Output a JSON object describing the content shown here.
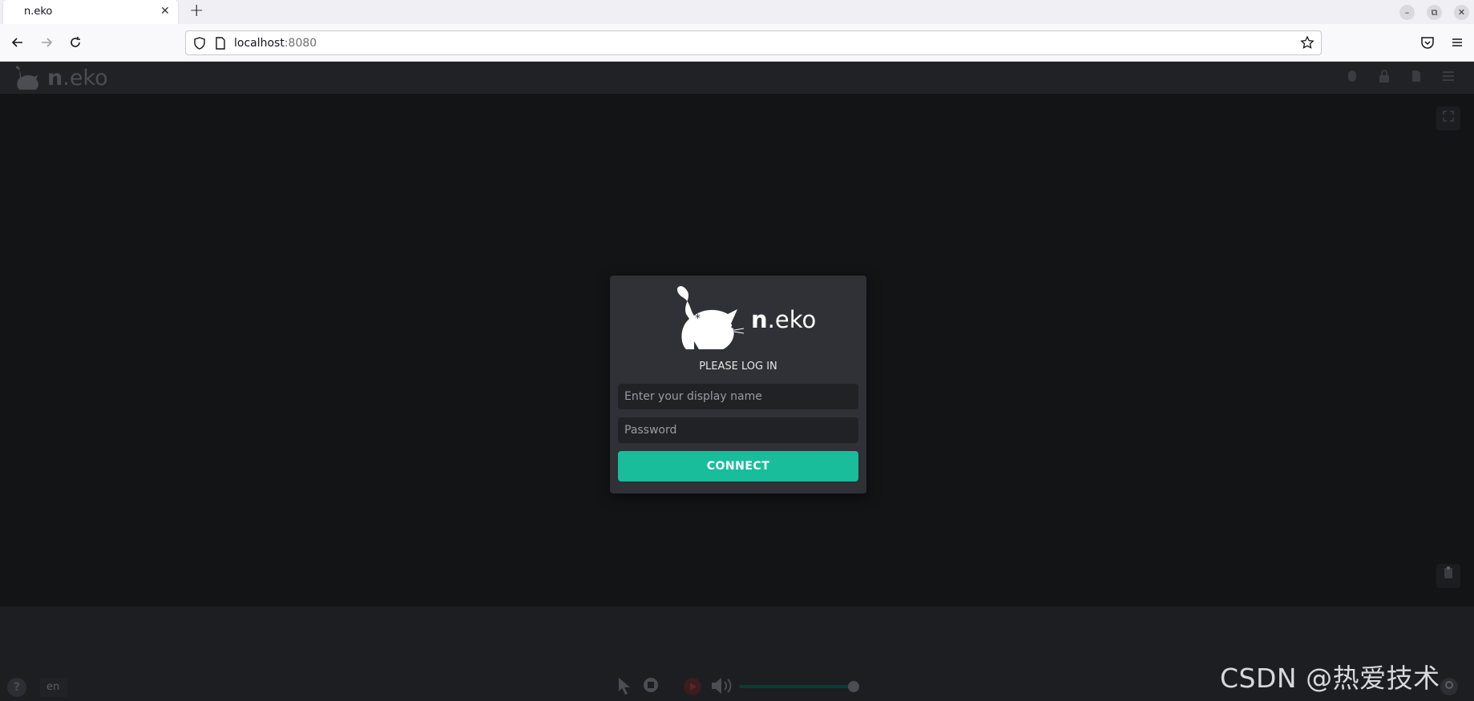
{
  "browser": {
    "tab_title": "n.eko",
    "tab_close": "✕",
    "new_tab": "+",
    "url_host": "localhost",
    "url_port": ":8080",
    "window_controls": [
      "–",
      "⧉",
      "✕"
    ]
  },
  "header": {
    "logo_bold": "n",
    "logo_rest": ".eko"
  },
  "login": {
    "logo_bold": "n",
    "logo_rest": ".eko",
    "heading": "PLEASE LOG IN",
    "display_name_placeholder": "Enter your display name",
    "password_placeholder": "Password",
    "connect_label": "CONNECT"
  },
  "footer": {
    "help": "?",
    "language": "en"
  },
  "watermark": "CSDN @热爱技术。",
  "colors": {
    "accent": "#19bd9c",
    "card": "#2f3136",
    "background": "#131416"
  },
  "icons": [
    "mouse-icon",
    "lock-icon",
    "file-icon",
    "menu-icon",
    "fullscreen-icon",
    "clipboard-icon",
    "cursor-icon",
    "stop-icon",
    "play-icon",
    "volume-icon"
  ]
}
